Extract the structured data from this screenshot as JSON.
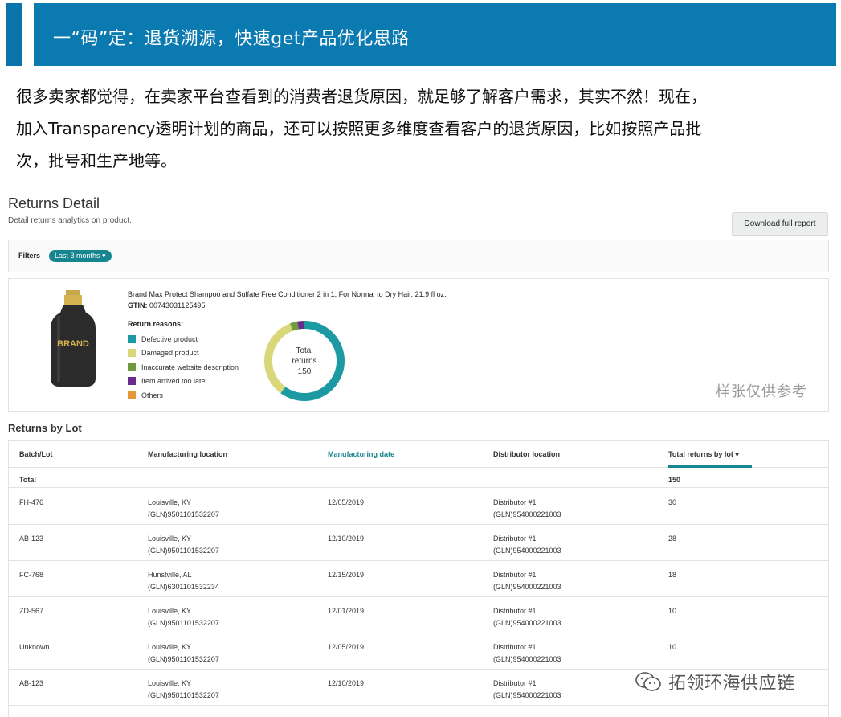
{
  "banner": {
    "title": "一“码”定：退货溯源，快速get产品优化思路"
  },
  "intro": {
    "lines": [
      "很多卖家都觉得，在卖家平台查看到的消费者退货原因，就足够了解客户需求，其实不然！现在，",
      "加入Transparency透明计划的商品，还可以按照更多维度查看客户的退货原因，比如按照产品批",
      "次，批号和生产地等。"
    ]
  },
  "returns_detail": {
    "title": "Returns Detail",
    "subtitle": "Detail returns analytics on product.",
    "download_label": "Download full report",
    "filters_label": "Filters",
    "filter_chip": "Last 3 months ▾"
  },
  "product": {
    "bottle_text": "BRAND",
    "name": "Brand Max Protect Shampoo and Sulfate Free Conditioner 2 in 1, For Normal to Dry Hair, 21.9 fl oz.",
    "gtin_label": "GTIN:",
    "gtin_value": " 00743031125495",
    "reasons_label": "Return reasons:",
    "reasons": [
      {
        "label": "Defective product",
        "color": "#1b9aa3"
      },
      {
        "label": "Damaged product",
        "color": "#d9d77a"
      },
      {
        "label": "Inaccurate website description",
        "color": "#6f9a3e"
      },
      {
        "label": "Item arrived too late",
        "color": "#6a2c8c"
      },
      {
        "label": "Others",
        "color": "#e8963a"
      }
    ],
    "donut_center": [
      "Total",
      "returns",
      "150"
    ],
    "watermark": "样张仅供参考"
  },
  "chart_data": {
    "type": "pie",
    "title": "Total returns 150",
    "categories": [
      "Defective product",
      "Damaged product",
      "Inaccurate website description",
      "Item arrived too late",
      "Others"
    ],
    "values": [
      0.6,
      0.34,
      0.03,
      0.03,
      0.0
    ],
    "colors": [
      "#1b9aa3",
      "#d9d77a",
      "#6f9a3e",
      "#6a2c8c",
      "#e8963a"
    ],
    "donut": true
  },
  "returns_by_lot": {
    "title": "Returns by Lot",
    "columns": [
      "Batch/Lot",
      "Manufacturing location",
      "Manufacturing date",
      "Distributor location",
      "Total returns by lot ▾"
    ],
    "total_row": {
      "label": "Total",
      "value": "150"
    },
    "rows": [
      {
        "lot": "FH-476",
        "loc1": "Louisville, KY",
        "loc2": "(GLN)9501101532207",
        "date": "12/05/2019",
        "dist1": "Distributor #1",
        "dist2": "(GLN)954000221003",
        "total": "30"
      },
      {
        "lot": "AB-123",
        "loc1": "Louisville, KY",
        "loc2": "(GLN)9501101532207",
        "date": "12/10/2019",
        "dist1": "Distributor #1",
        "dist2": "(GLN)954000221003",
        "total": "28"
      },
      {
        "lot": "FC-768",
        "loc1": "Hunstville, AL",
        "loc2": "(GLN)6301101532234",
        "date": "12/15/2019",
        "dist1": "Distributor #1",
        "dist2": "(GLN)954000221003",
        "total": "18"
      },
      {
        "lot": "ZD-567",
        "loc1": "Louisville, KY",
        "loc2": "(GLN)9501101532207",
        "date": "12/01/2019",
        "dist1": "Distributor #1",
        "dist2": "(GLN)954000221003",
        "total": "10"
      },
      {
        "lot": "Unknown",
        "loc1": "Louisville, KY",
        "loc2": "(GLN)9501101532207",
        "date": "12/05/2019",
        "dist1": "Distributor #1",
        "dist2": "(GLN)954000221003",
        "total": "10"
      },
      {
        "lot": "AB-123",
        "loc1": "Louisville, KY",
        "loc2": "(GLN)9501101532207",
        "date": "12/10/2019",
        "dist1": "Distributor #1",
        "dist2": "(GLN)954000221003",
        "total": ""
      }
    ]
  },
  "footer_watermark": {
    "text": "拓领环海供应链",
    "icon": "wechat-icon"
  }
}
